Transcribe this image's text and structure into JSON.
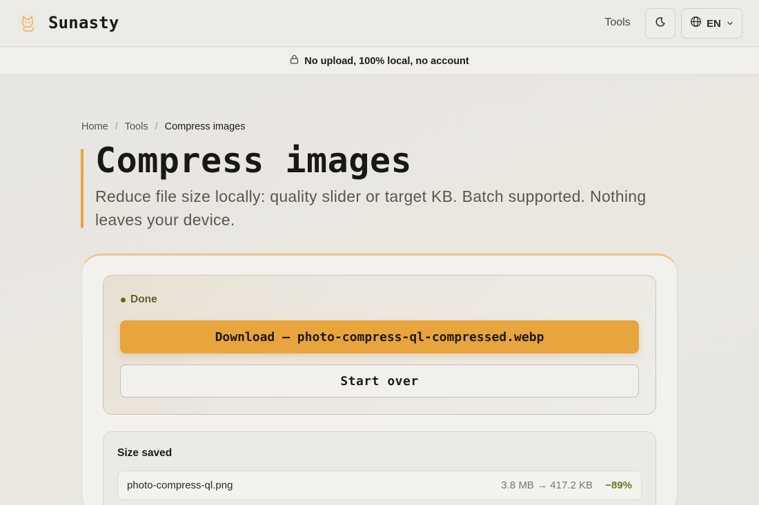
{
  "header": {
    "brand": "Sunasty",
    "logo_icon": "cat-logo-icon",
    "nav_tools": "Tools",
    "theme_icon": "moon-icon",
    "language": "EN"
  },
  "banner": {
    "text": "No upload, 100% local, no account",
    "icon": "lock-icon"
  },
  "breadcrumb": {
    "home": "Home",
    "tools": "Tools",
    "current": "Compress images",
    "separator": "/"
  },
  "page": {
    "title": "Compress images",
    "subtitle": "Reduce file size locally: quality slider or target KB. Batch supported. Nothing leaves your device."
  },
  "result": {
    "status": "Done",
    "download_label": "Download — photo-compress-ql-compressed.webp",
    "restart_label": "Start over"
  },
  "size_saved": {
    "title": "Size saved",
    "files": [
      {
        "name": "photo-compress-ql.png",
        "sizes": "3.8 MB → 417.2 KB",
        "change": "−89%"
      }
    ]
  },
  "colors": {
    "accent": "#e8a43d",
    "success": "#5f7a22",
    "background": "#e9e7e2"
  }
}
